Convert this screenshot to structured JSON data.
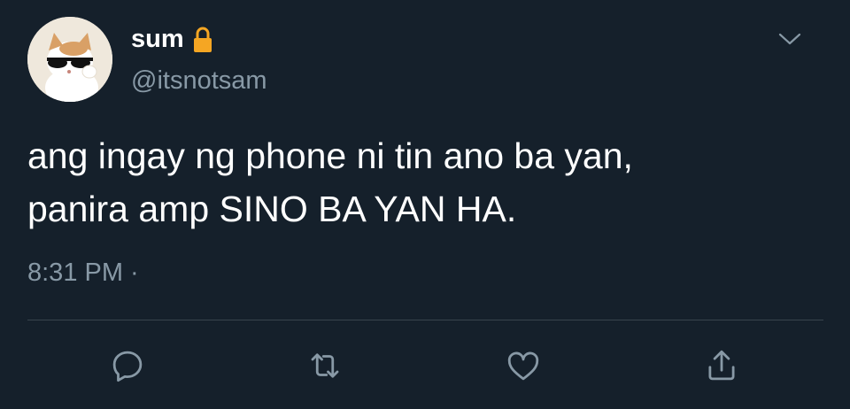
{
  "user": {
    "display_name": "sum",
    "handle": "@itsnotsam",
    "avatar_icon": "cat-with-sunglasses-avatar",
    "protected_icon": "lock-icon"
  },
  "tweet": {
    "text_lines": [
      "ang ingay ng phone ni tin ano ba yan,",
      "panira amp SINO BA YAN HA."
    ],
    "timestamp": "8:31 PM ·"
  },
  "actions": {
    "reply_icon": "reply-icon",
    "retweet_icon": "retweet-icon",
    "like_icon": "heart-icon",
    "share_icon": "share-icon",
    "menu_icon": "chevron-down-icon"
  },
  "colors": {
    "background": "#15202b",
    "primary_text": "#ffffff",
    "secondary_text": "#8899a6",
    "divider": "#38444d",
    "lock": "#f5a623"
  }
}
